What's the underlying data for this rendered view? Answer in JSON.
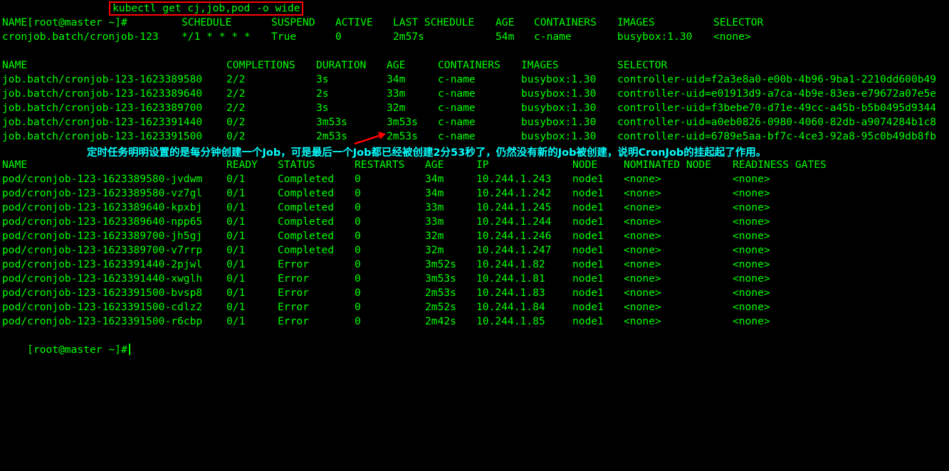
{
  "colors": {
    "background": "#000000",
    "text": "#00ff00",
    "highlight_box": "#ff0000",
    "annotation": "#00ffff",
    "arrow": "#ff0000"
  },
  "command": {
    "prompt": "[root@master ~]#",
    "text": "kubectl get cj,job,pod -o wide"
  },
  "cronjobs": {
    "headers": [
      "NAME",
      "SCHEDULE",
      "SUSPEND",
      "ACTIVE",
      "LAST SCHEDULE",
      "AGE",
      "CONTAINERS",
      "IMAGES",
      "SELECTOR"
    ],
    "rows": [
      [
        "cronjob.batch/cronjob-123",
        "*/1 * * * *",
        "True",
        "0",
        "2m57s",
        "54m",
        "c-name",
        "busybox:1.30",
        "<none>"
      ]
    ]
  },
  "jobs": {
    "headers": [
      "NAME",
      "COMPLETIONS",
      "DURATION",
      "AGE",
      "CONTAINERS",
      "IMAGES",
      "SELECTOR"
    ],
    "rows": [
      [
        "job.batch/cronjob-123-1623389580",
        "2/2",
        "3s",
        "34m",
        "c-name",
        "busybox:1.30",
        "controller-uid=f2a3e8a0-e00b-4b96-9ba1-2210dd600b49"
      ],
      [
        "job.batch/cronjob-123-1623389640",
        "2/2",
        "2s",
        "33m",
        "c-name",
        "busybox:1.30",
        "controller-uid=e01913d9-a7ca-4b9e-83ea-e79672a07e5e"
      ],
      [
        "job.batch/cronjob-123-1623389700",
        "2/2",
        "3s",
        "32m",
        "c-name",
        "busybox:1.30",
        "controller-uid=f3bebe70-d71e-49cc-a45b-b5b0495d9344"
      ],
      [
        "job.batch/cronjob-123-1623391440",
        "0/2",
        "3m53s",
        "3m53s",
        "c-name",
        "busybox:1.30",
        "controller-uid=a0eb0826-0980-4060-82db-a9074284b1c8"
      ],
      [
        "job.batch/cronjob-123-1623391500",
        "0/2",
        "2m53s",
        "2m53s",
        "c-name",
        "busybox:1.30",
        "controller-uid=6789e5aa-bf7c-4ce3-92a8-95c0b49db8fb"
      ]
    ]
  },
  "annotation": "定时任务明明设置的是每分钟创建一个Job，可是最后一个Job都已经被创建2分53秒了，仍然没有新的Job被创建，说明CronJob的挂起起了作用。",
  "pods": {
    "headers": [
      "NAME",
      "READY",
      "STATUS",
      "RESTARTS",
      "AGE",
      "IP",
      "NODE",
      "NOMINATED NODE",
      "READINESS GATES"
    ],
    "rows": [
      [
        "pod/cronjob-123-1623389580-jvdwm",
        "0/1",
        "Completed",
        "0",
        "34m",
        "10.244.1.243",
        "node1",
        "<none>",
        "<none>"
      ],
      [
        "pod/cronjob-123-1623389580-vz7gl",
        "0/1",
        "Completed",
        "0",
        "34m",
        "10.244.1.242",
        "node1",
        "<none>",
        "<none>"
      ],
      [
        "pod/cronjob-123-1623389640-kpxbj",
        "0/1",
        "Completed",
        "0",
        "33m",
        "10.244.1.245",
        "node1",
        "<none>",
        "<none>"
      ],
      [
        "pod/cronjob-123-1623389640-npp65",
        "0/1",
        "Completed",
        "0",
        "33m",
        "10.244.1.244",
        "node1",
        "<none>",
        "<none>"
      ],
      [
        "pod/cronjob-123-1623389700-jh5gj",
        "0/1",
        "Completed",
        "0",
        "32m",
        "10.244.1.246",
        "node1",
        "<none>",
        "<none>"
      ],
      [
        "pod/cronjob-123-1623389700-v7rrp",
        "0/1",
        "Completed",
        "0",
        "32m",
        "10.244.1.247",
        "node1",
        "<none>",
        "<none>"
      ],
      [
        "pod/cronjob-123-1623391440-2pjwl",
        "0/1",
        "Error",
        "0",
        "3m52s",
        "10.244.1.82",
        "node1",
        "<none>",
        "<none>"
      ],
      [
        "pod/cronjob-123-1623391440-xwglh",
        "0/1",
        "Error",
        "0",
        "3m53s",
        "10.244.1.81",
        "node1",
        "<none>",
        "<none>"
      ],
      [
        "pod/cronjob-123-1623391500-bvsp8",
        "0/1",
        "Error",
        "0",
        "2m53s",
        "10.244.1.83",
        "node1",
        "<none>",
        "<none>"
      ],
      [
        "pod/cronjob-123-1623391500-cdlz2",
        "0/1",
        "Error",
        "0",
        "2m52s",
        "10.244.1.84",
        "node1",
        "<none>",
        "<none>"
      ],
      [
        "pod/cronjob-123-1623391500-r6cbp",
        "0/1",
        "Error",
        "0",
        "2m42s",
        "10.244.1.85",
        "node1",
        "<none>",
        "<none>"
      ]
    ]
  },
  "final_prompt": "[root@master ~]#"
}
